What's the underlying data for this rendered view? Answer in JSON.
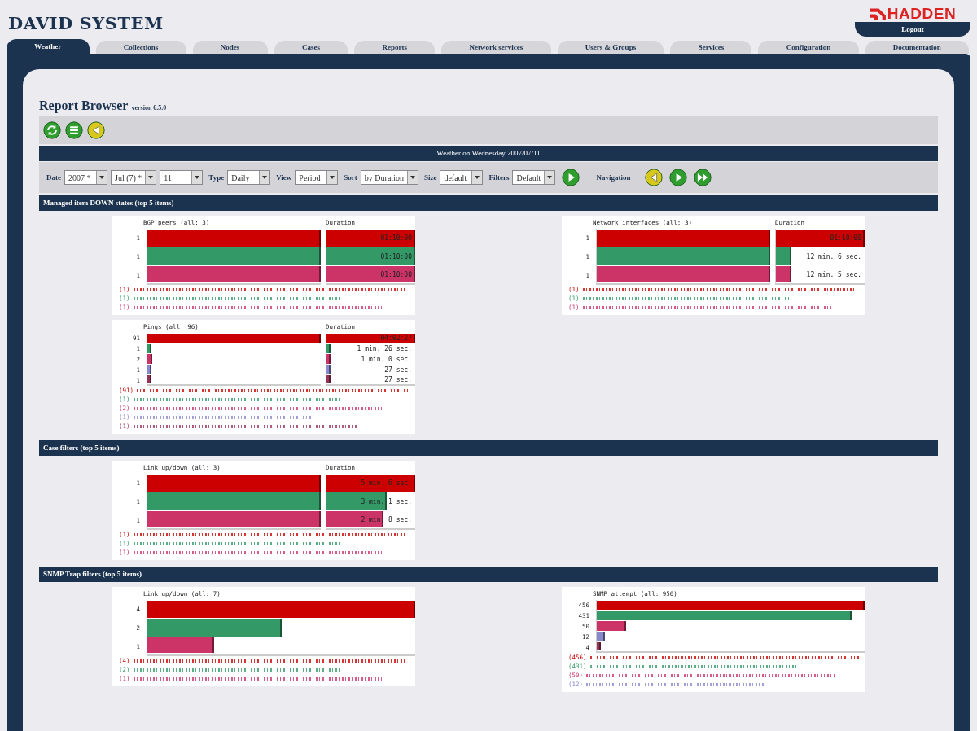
{
  "header": {
    "title": "DAVID SYSTEM",
    "logo": "HADDEN",
    "logout": "Logout"
  },
  "tabs": [
    {
      "label": "Weather",
      "selected": true
    },
    {
      "label": "Collections",
      "selected": false
    },
    {
      "label": "Nodes",
      "selected": false
    },
    {
      "label": "Cases",
      "selected": false
    },
    {
      "label": "Reports",
      "selected": false
    },
    {
      "label": "Network services",
      "selected": false
    },
    {
      "label": "Users & Groups",
      "selected": false
    },
    {
      "label": "Services",
      "selected": false
    },
    {
      "label": "Configuration",
      "selected": false
    },
    {
      "label": "Documentation",
      "selected": false
    }
  ],
  "page": {
    "title": "Report Browser",
    "version": "version 6.5.0"
  },
  "toolbar": [
    {
      "kind": "refresh"
    },
    {
      "kind": "list"
    },
    {
      "kind": "back"
    }
  ],
  "report_title": "Weather on Wednesday 2007/07/11",
  "filters": [
    {
      "label": "Date",
      "dropdowns": [
        "2007 *",
        "Jul (7) *",
        "11"
      ]
    },
    {
      "label": "Type",
      "dropdowns": [
        "Daily"
      ]
    },
    {
      "label": "View",
      "dropdowns": [
        "Period"
      ]
    },
    {
      "label": "Sort",
      "dropdowns": [
        "by Duration"
      ]
    },
    {
      "label": "Size",
      "dropdowns": [
        "default"
      ]
    },
    {
      "label": "Filters",
      "dropdowns": [
        "Default"
      ]
    }
  ],
  "navigation": {
    "label": "Navigation",
    "buttons": [
      {
        "kind": "previous"
      },
      {
        "kind": "next"
      },
      {
        "kind": "last"
      }
    ]
  },
  "sections": [
    {
      "title": "Managed item DOWN states (top 5 items)",
      "charts": [
        {
          "title": "BGP peers (all: 3)",
          "duration_title": "Duration",
          "items": [
            {
              "count": "1",
              "color": "#cc0000",
              "bar": {
                "level": 1
              },
              "duration": {
                "text": "01:10:00",
                "level": 1
              },
              "legend": "(1)"
            },
            {
              "count": "1",
              "color": "#339966",
              "bar": {
                "level": 1
              },
              "duration": {
                "text": "01:10:00",
                "level": 1
              },
              "legend": "(1)"
            },
            {
              "count": "1",
              "color": "#cc3366",
              "bar": {
                "level": 1
              },
              "duration": {
                "text": "01:10:00",
                "level": 1
              },
              "legend": "(1)"
            }
          ]
        },
        {
          "title": "Network interfaces (all: 3)",
          "duration_title": "Duration",
          "items": [
            {
              "count": "1",
              "color": "#cc0000",
              "bar": {
                "level": 1
              },
              "duration": {
                "text": "01:10:00",
                "level": 1
              },
              "legend": "(1)"
            },
            {
              "count": "1",
              "color": "#339966",
              "bar": {
                "level": 1
              },
              "duration": {
                "text": "12 min. 6 sec.",
                "level": 0.17
              },
              "legend": "(1)"
            },
            {
              "count": "1",
              "color": "#cc3366",
              "bar": {
                "level": 1
              },
              "duration": {
                "text": "12 min. 5 sec.",
                "level": 0.17
              },
              "legend": "(1)"
            }
          ]
        },
        {
          "title": "Pings (all: 96)",
          "duration_title": "Duration",
          "items": [
            {
              "count": "91",
              "color": "#cc0000",
              "bar": {
                "level": 1
              },
              "duration": {
                "text": "04:02:27",
                "level": 1
              },
              "legend": "(91)"
            },
            {
              "count": "1",
              "color": "#339966",
              "bar": {
                "level": 0.02
              },
              "duration": {
                "text": "1 min. 26 sec.",
                "level": 0.04
              },
              "legend": "(1)"
            },
            {
              "count": "2",
              "color": "#cc3366",
              "bar": {
                "level": 0.03
              },
              "duration": {
                "text": "1 min. 0 sec.",
                "level": 0.04
              },
              "legend": "(2)"
            },
            {
              "count": "1",
              "color": "#8888cc",
              "bar": {
                "level": 0.02
              },
              "duration": {
                "text": "27 sec.",
                "level": 0.03
              },
              "legend": "(1)"
            },
            {
              "count": "1",
              "color": "#993355",
              "bar": {
                "level": 0.02
              },
              "duration": {
                "text": "27 sec.",
                "level": 0.03
              },
              "legend": "(1)"
            }
          ]
        }
      ]
    },
    {
      "title": "Case filters (top 5 items)",
      "charts": [
        {
          "title": "Link up/down (all: 3)",
          "duration_title": "Duration",
          "items": [
            {
              "count": "1",
              "color": "#cc0000",
              "bar": {
                "level": 1
              },
              "duration": {
                "text": "5 min. 6 sec.",
                "level": 1
              },
              "legend": "(1)"
            },
            {
              "count": "1",
              "color": "#339966",
              "bar": {
                "level": 1
              },
              "duration": {
                "text": "3 min. 1 sec.",
                "level": 0.68
              },
              "legend": "(1)"
            },
            {
              "count": "1",
              "color": "#cc3366",
              "bar": {
                "level": 1
              },
              "duration": {
                "text": "2 min. 8 sec.",
                "level": 0.64
              },
              "legend": "(1)"
            }
          ]
        }
      ]
    },
    {
      "title": "SNMP Trap filters (top 5 items)",
      "charts": [
        {
          "title": "Link up/down (all: 7)",
          "items": [
            {
              "count": "4",
              "color": "#cc0000",
              "bar": {
                "level": 1
              },
              "legend": "(4)"
            },
            {
              "count": "2",
              "color": "#339966",
              "bar": {
                "level": 0.5
              },
              "legend": "(2)"
            },
            {
              "count": "1",
              "color": "#cc3366",
              "bar": {
                "level": 0.25
              },
              "legend": "(1)"
            }
          ]
        },
        {
          "title": "SNMP attempt (all: 950)",
          "items": [
            {
              "count": "456",
              "color": "#cc0000",
              "bar": {
                "level": 1
              },
              "legend": "(456)"
            },
            {
              "count": "431",
              "color": "#339966",
              "bar": {
                "level": 0.95
              },
              "legend": "(431)"
            },
            {
              "count": "50",
              "color": "#cc3366",
              "bar": {
                "level": 0.11
              },
              "legend": "(50)"
            },
            {
              "count": "12",
              "color": "#8888cc",
              "bar": {
                "level": 0.03
              },
              "legend": "(12)"
            },
            {
              "count": "4",
              "color": "#993355",
              "bar": {
                "level": 0.01
              }
            }
          ]
        }
      ]
    }
  ]
}
